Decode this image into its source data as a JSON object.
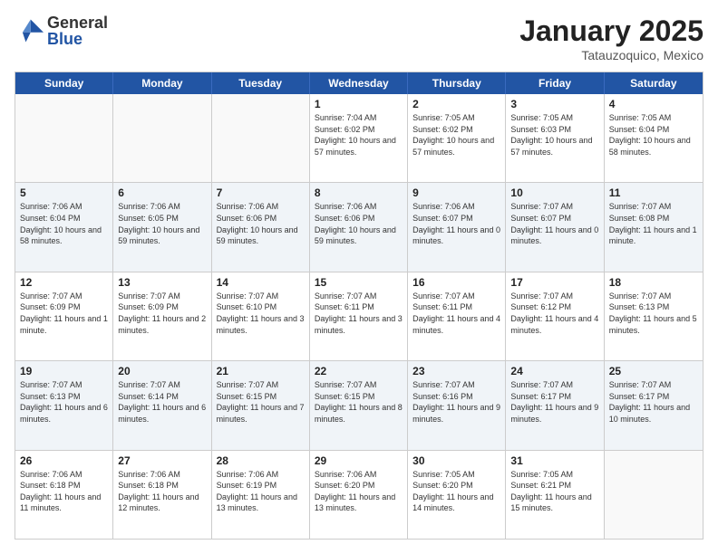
{
  "header": {
    "logo_general": "General",
    "logo_blue": "Blue",
    "title": "January 2025",
    "location": "Tatauzoquico, Mexico"
  },
  "weekdays": [
    "Sunday",
    "Monday",
    "Tuesday",
    "Wednesday",
    "Thursday",
    "Friday",
    "Saturday"
  ],
  "rows": [
    {
      "alt": false,
      "cells": [
        {
          "day": "",
          "info": ""
        },
        {
          "day": "",
          "info": ""
        },
        {
          "day": "",
          "info": ""
        },
        {
          "day": "1",
          "info": "Sunrise: 7:04 AM\nSunset: 6:02 PM\nDaylight: 10 hours\nand 57 minutes."
        },
        {
          "day": "2",
          "info": "Sunrise: 7:05 AM\nSunset: 6:02 PM\nDaylight: 10 hours\nand 57 minutes."
        },
        {
          "day": "3",
          "info": "Sunrise: 7:05 AM\nSunset: 6:03 PM\nDaylight: 10 hours\nand 57 minutes."
        },
        {
          "day": "4",
          "info": "Sunrise: 7:05 AM\nSunset: 6:04 PM\nDaylight: 10 hours\nand 58 minutes."
        }
      ]
    },
    {
      "alt": true,
      "cells": [
        {
          "day": "5",
          "info": "Sunrise: 7:06 AM\nSunset: 6:04 PM\nDaylight: 10 hours\nand 58 minutes."
        },
        {
          "day": "6",
          "info": "Sunrise: 7:06 AM\nSunset: 6:05 PM\nDaylight: 10 hours\nand 59 minutes."
        },
        {
          "day": "7",
          "info": "Sunrise: 7:06 AM\nSunset: 6:06 PM\nDaylight: 10 hours\nand 59 minutes."
        },
        {
          "day": "8",
          "info": "Sunrise: 7:06 AM\nSunset: 6:06 PM\nDaylight: 10 hours\nand 59 minutes."
        },
        {
          "day": "9",
          "info": "Sunrise: 7:06 AM\nSunset: 6:07 PM\nDaylight: 11 hours\nand 0 minutes."
        },
        {
          "day": "10",
          "info": "Sunrise: 7:07 AM\nSunset: 6:07 PM\nDaylight: 11 hours\nand 0 minutes."
        },
        {
          "day": "11",
          "info": "Sunrise: 7:07 AM\nSunset: 6:08 PM\nDaylight: 11 hours\nand 1 minute."
        }
      ]
    },
    {
      "alt": false,
      "cells": [
        {
          "day": "12",
          "info": "Sunrise: 7:07 AM\nSunset: 6:09 PM\nDaylight: 11 hours\nand 1 minute."
        },
        {
          "day": "13",
          "info": "Sunrise: 7:07 AM\nSunset: 6:09 PM\nDaylight: 11 hours\nand 2 minutes."
        },
        {
          "day": "14",
          "info": "Sunrise: 7:07 AM\nSunset: 6:10 PM\nDaylight: 11 hours\nand 3 minutes."
        },
        {
          "day": "15",
          "info": "Sunrise: 7:07 AM\nSunset: 6:11 PM\nDaylight: 11 hours\nand 3 minutes."
        },
        {
          "day": "16",
          "info": "Sunrise: 7:07 AM\nSunset: 6:11 PM\nDaylight: 11 hours\nand 4 minutes."
        },
        {
          "day": "17",
          "info": "Sunrise: 7:07 AM\nSunset: 6:12 PM\nDaylight: 11 hours\nand 4 minutes."
        },
        {
          "day": "18",
          "info": "Sunrise: 7:07 AM\nSunset: 6:13 PM\nDaylight: 11 hours\nand 5 minutes."
        }
      ]
    },
    {
      "alt": true,
      "cells": [
        {
          "day": "19",
          "info": "Sunrise: 7:07 AM\nSunset: 6:13 PM\nDaylight: 11 hours\nand 6 minutes."
        },
        {
          "day": "20",
          "info": "Sunrise: 7:07 AM\nSunset: 6:14 PM\nDaylight: 11 hours\nand 6 minutes."
        },
        {
          "day": "21",
          "info": "Sunrise: 7:07 AM\nSunset: 6:15 PM\nDaylight: 11 hours\nand 7 minutes."
        },
        {
          "day": "22",
          "info": "Sunrise: 7:07 AM\nSunset: 6:15 PM\nDaylight: 11 hours\nand 8 minutes."
        },
        {
          "day": "23",
          "info": "Sunrise: 7:07 AM\nSunset: 6:16 PM\nDaylight: 11 hours\nand 9 minutes."
        },
        {
          "day": "24",
          "info": "Sunrise: 7:07 AM\nSunset: 6:17 PM\nDaylight: 11 hours\nand 9 minutes."
        },
        {
          "day": "25",
          "info": "Sunrise: 7:07 AM\nSunset: 6:17 PM\nDaylight: 11 hours\nand 10 minutes."
        }
      ]
    },
    {
      "alt": false,
      "cells": [
        {
          "day": "26",
          "info": "Sunrise: 7:06 AM\nSunset: 6:18 PM\nDaylight: 11 hours\nand 11 minutes."
        },
        {
          "day": "27",
          "info": "Sunrise: 7:06 AM\nSunset: 6:18 PM\nDaylight: 11 hours\nand 12 minutes."
        },
        {
          "day": "28",
          "info": "Sunrise: 7:06 AM\nSunset: 6:19 PM\nDaylight: 11 hours\nand 13 minutes."
        },
        {
          "day": "29",
          "info": "Sunrise: 7:06 AM\nSunset: 6:20 PM\nDaylight: 11 hours\nand 13 minutes."
        },
        {
          "day": "30",
          "info": "Sunrise: 7:05 AM\nSunset: 6:20 PM\nDaylight: 11 hours\nand 14 minutes."
        },
        {
          "day": "31",
          "info": "Sunrise: 7:05 AM\nSunset: 6:21 PM\nDaylight: 11 hours\nand 15 minutes."
        },
        {
          "day": "",
          "info": ""
        }
      ]
    }
  ]
}
